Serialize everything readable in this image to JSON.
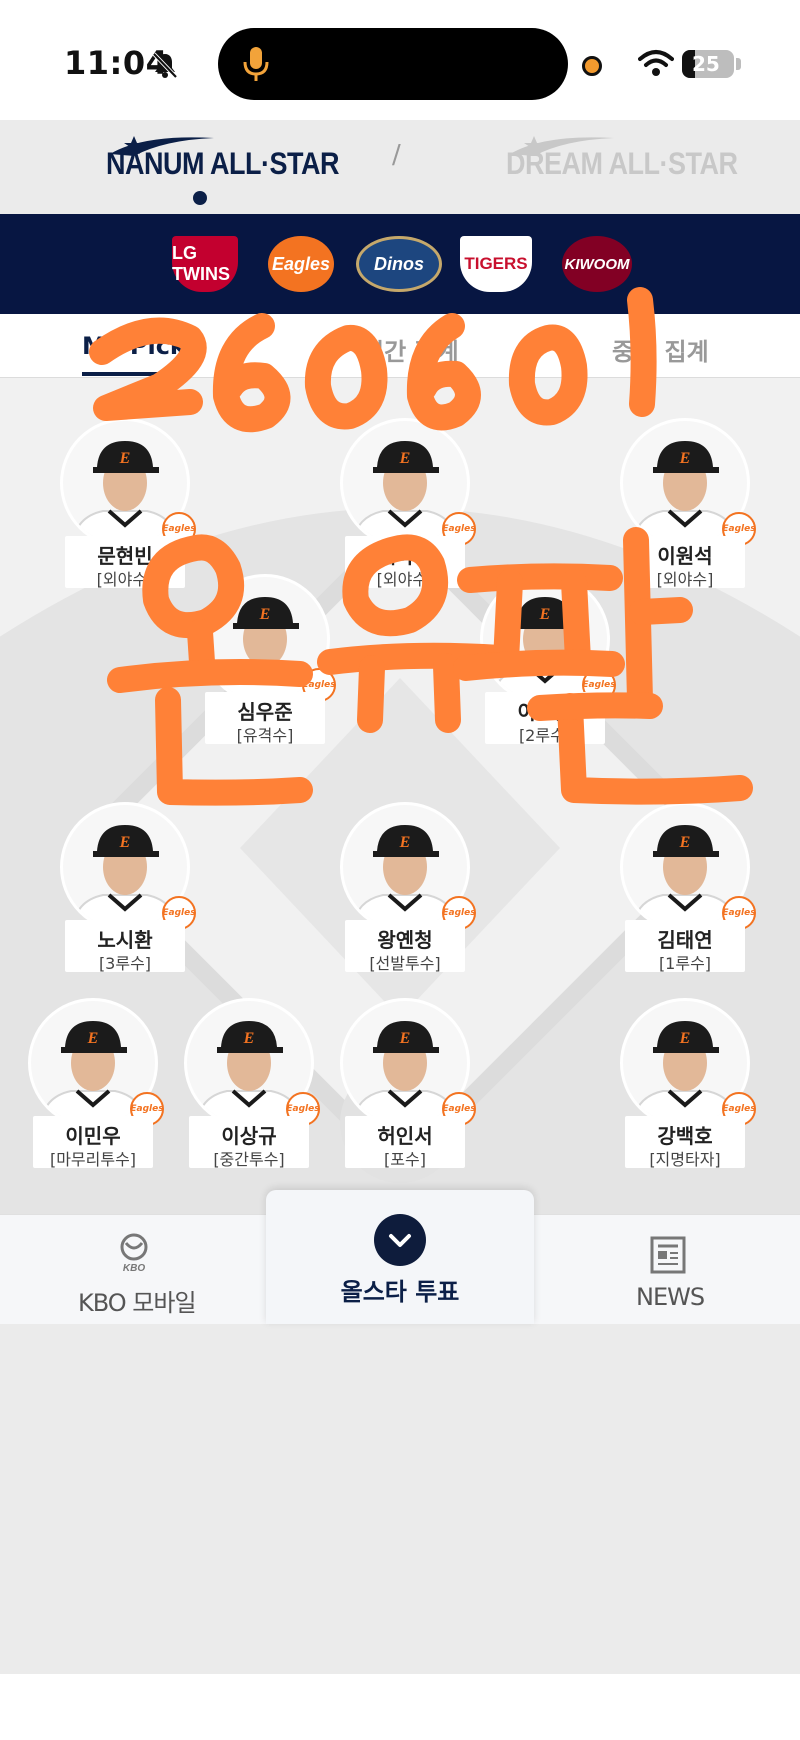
{
  "status_bar": {
    "time": "11:04",
    "battery": "25",
    "battery_fraction": 0.25,
    "icons": [
      "bell-slash-icon",
      "microphone-icon",
      "recording-dot-icon",
      "wifi-icon",
      "battery-icon"
    ]
  },
  "league_tabs": [
    {
      "label": "NANUM ALL·STAR",
      "active": true
    },
    {
      "label": "DREAM ALL·STAR",
      "active": false
    }
  ],
  "league_separator": "/",
  "teams": [
    {
      "name": "LG TWINS",
      "color": "#c3002f"
    },
    {
      "name": "Eagles",
      "color": "#f37321"
    },
    {
      "name": "Dinos",
      "color": "#1d467f"
    },
    {
      "name": "TIGERS",
      "color": "#c8102e"
    },
    {
      "name": "KIWOOM",
      "color": "#820024"
    }
  ],
  "sub_tabs": [
    {
      "label": "My Pick",
      "active": true
    },
    {
      "label": "시간 집계",
      "active": false
    },
    {
      "label": "중간 집계",
      "active": false
    }
  ],
  "players": [
    {
      "name": "문현빈",
      "position": "[외야수]"
    },
    {
      "name": "페라자",
      "position": "[외야수]"
    },
    {
      "name": "이원석",
      "position": "[외야수]"
    },
    {
      "name": "심우준",
      "position": "[유격수]"
    },
    {
      "name": "이도윤",
      "position": "[2루수]"
    },
    {
      "name": "노시환",
      "position": "[3루수]"
    },
    {
      "name": "왕옌청",
      "position": "[선발투수]"
    },
    {
      "name": "김태연",
      "position": "[1루수]"
    },
    {
      "name": "이민우",
      "position": "[마무리투수]"
    },
    {
      "name": "이상규",
      "position": "[중간투수]"
    },
    {
      "name": "허인서",
      "position": "[포수]"
    },
    {
      "name": "강백호",
      "position": "[지명타자]"
    }
  ],
  "player_badge": "Eagles",
  "bottom_nav": {
    "left_label": "KBO 모바일",
    "left_icon_text": "KBO",
    "center_label": "올스타 투표",
    "right_label": "NEWS"
  },
  "handwriting": [
    "2606이",
    "온유판"
  ],
  "colors": {
    "navy": "#0b1f47",
    "team_bar": "#071642",
    "eagles_orange": "#f37321",
    "handwriting_orange": "#ff8137"
  }
}
